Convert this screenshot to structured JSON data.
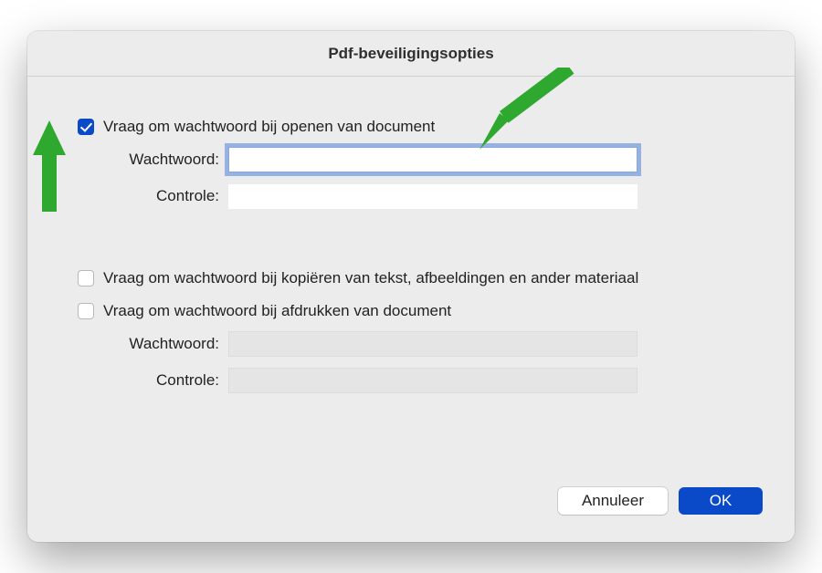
{
  "dialog": {
    "title": "Pdf-beveiligingsopties",
    "openSection": {
      "requireLabel": "Vraag om wachtwoord bij openen van document",
      "requireChecked": true,
      "passwordLabel": "Wachtwoord:",
      "passwordValue": "",
      "verifyLabel": "Controle:",
      "verifyValue": ""
    },
    "permSection": {
      "copyLabel": "Vraag om wachtwoord bij kopiëren van tekst, afbeeldingen en ander materiaal",
      "copyChecked": false,
      "printLabel": "Vraag om wachtwoord bij afdrukken van document",
      "printChecked": false,
      "passwordLabel": "Wachtwoord:",
      "passwordValue": "",
      "verifyLabel": "Controle:",
      "verifyValue": ""
    },
    "buttons": {
      "cancel": "Annuleer",
      "ok": "OK"
    }
  },
  "colors": {
    "accent": "#0a49c7",
    "arrow": "#2fa82f"
  }
}
